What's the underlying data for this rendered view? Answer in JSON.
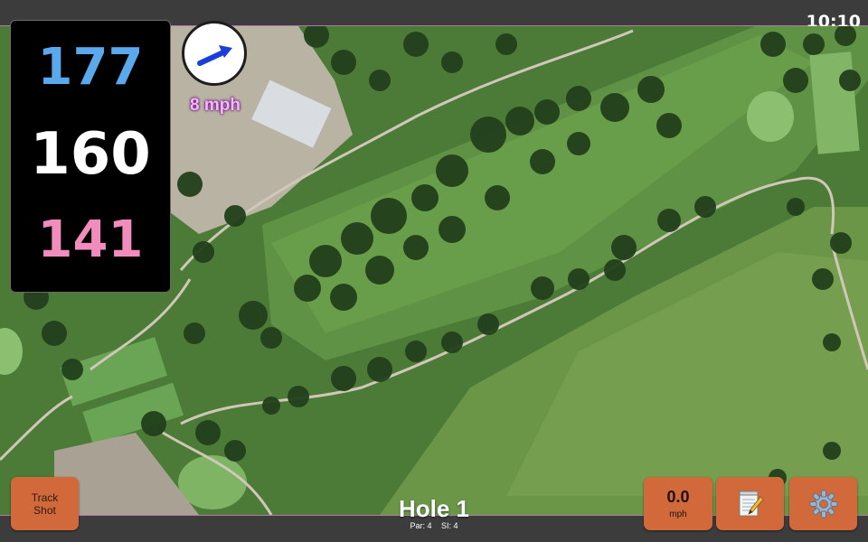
{
  "status_bar": {
    "time": "10:10"
  },
  "distances": {
    "back": "177",
    "middle": "160",
    "front": "141"
  },
  "wind": {
    "speed_label": "8 mph",
    "direction_icon": "arrow-right-up-icon"
  },
  "buttons": {
    "track_shot_line1": "Track",
    "track_shot_line2": "Shot",
    "wind_value": "0.0",
    "wind_unit": "mph",
    "notes_icon": "notepad-pencil-icon",
    "settings_icon": "gear-icon"
  },
  "hole": {
    "title": "Hole 1",
    "par_label": "Par: 4",
    "si_label": "SI: 4"
  },
  "colors": {
    "back_distance": "#5aa9ec",
    "middle_distance": "#ffffff",
    "front_distance": "#f28cbd",
    "button_orange": "#d2693a",
    "wind_label": "#f7b7ff"
  }
}
